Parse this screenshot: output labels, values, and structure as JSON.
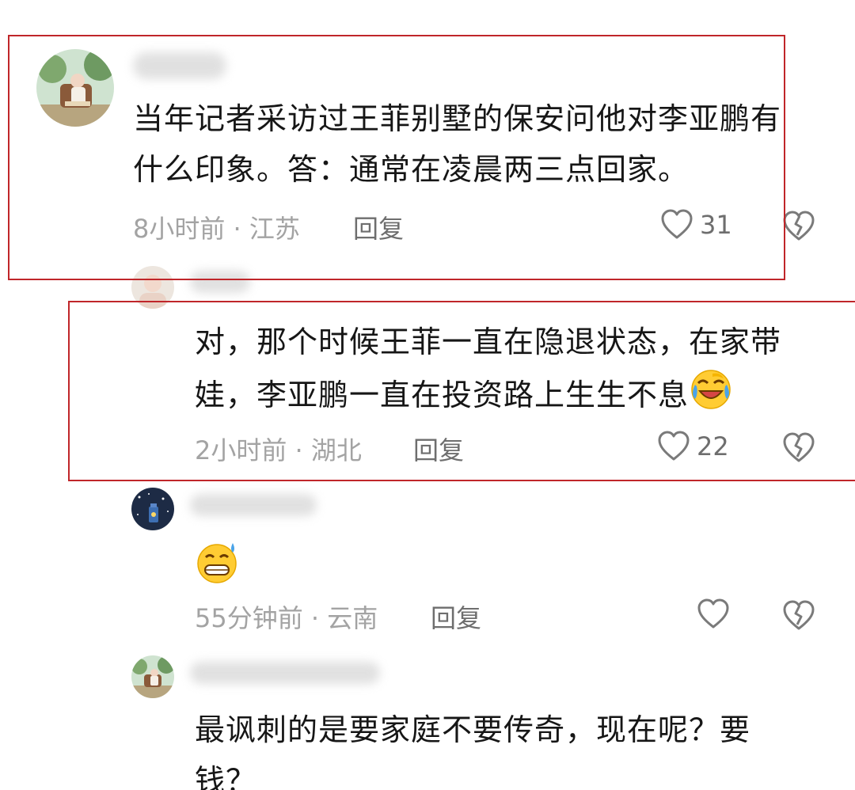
{
  "colors": {
    "highlight_border": "#c0262a",
    "meta_text": "#a3a3a3",
    "action_text": "#6e6e6e"
  },
  "comments": [
    {
      "body": "当年记者采访过王菲别墅的保安问他对李亚鹏有什么印象。答：通常在凌晨两三点回家。",
      "body_line1": "当年记者采访过王菲别墅的保安问他对李亚鹏有",
      "body_line2": "什么印象。答：通常在凌晨两三点回家。",
      "meta": "8小时前 · 江苏",
      "reply_label": "回复",
      "like_count": "31",
      "avatar_icon": "avatar-girl-reading-icon"
    },
    {
      "body_line1": "对，那个时候王菲一直在隐退状态，在家带",
      "body_line2": "娃，李亚鹏一直在投资路上生生不息",
      "emoji": "laughing-crying-face-icon",
      "meta": "2小时前 · 湖北",
      "reply_label": "回复",
      "like_count": "22",
      "avatar_icon": "avatar-light-icon"
    },
    {
      "emoji": "grinning-sweat-face-icon",
      "meta": "55分钟前 · 云南",
      "reply_label": "回复",
      "like_count": "",
      "avatar_icon": "avatar-starry-night-icon"
    },
    {
      "body_line1": "最讽刺的是要家庭不要传奇，现在呢？要",
      "body_line2": "钱？",
      "avatar_icon": "avatar-girl-reading-icon"
    }
  ]
}
